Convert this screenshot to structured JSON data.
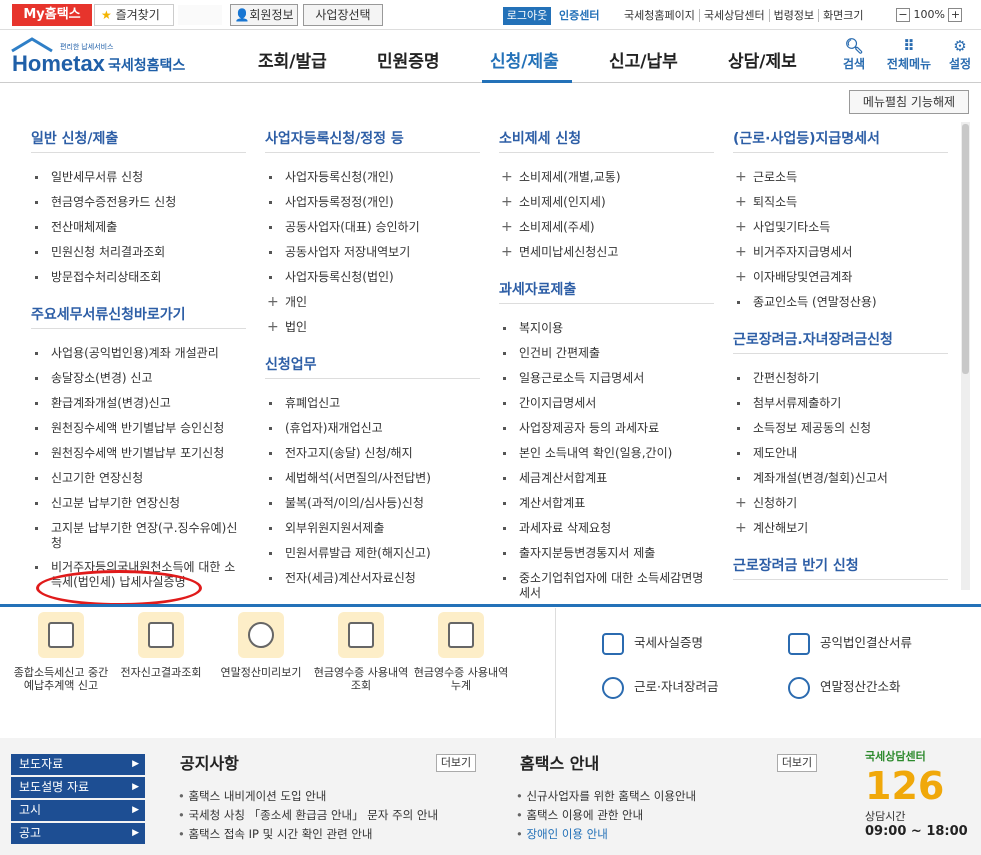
{
  "topbar": {
    "my_hometax": "My홈택스",
    "favorites": "즐겨찾기",
    "member_info": "회원정보",
    "biz_select": "사업장선택",
    "logout": "로그아웃",
    "cert_center": "인증센터",
    "links": [
      "국세청홈페이지",
      "국세상담센터",
      "법령정보",
      "화면크기"
    ],
    "zoom": "100%"
  },
  "logo": {
    "service": "HomeTax",
    "name": "국세청홈택스",
    "tagline": "편리한 납세서비스"
  },
  "gnb": {
    "items": [
      "조회/발급",
      "민원증명",
      "신청/제출",
      "신고/납부",
      "상담/제보"
    ],
    "active": "신청/제출",
    "search": "검색",
    "all_menu": "전체메뉴",
    "settings": "설정"
  },
  "menu": {
    "collapse_label": "메뉴펼침 기능해제",
    "col1": {
      "sec1": "일반 신청/제출",
      "items1": [
        "일반세무서류 신청",
        "현금영수증전용카드 신청",
        "전산매체제출",
        "민원신청 처리결과조회",
        "방문접수처리상태조회"
      ],
      "sec2": "주요세무서류신청바로가기",
      "items2": [
        "사업용(공익법인용)계좌 개설관리",
        "송달장소(변경) 신고",
        "환급계좌개설(변경)신고",
        "원천징수세액 반기별납부 승인신청",
        "원천징수세액 반기별납부 포기신청",
        "신고기한 연장신청",
        "신고분 납부기한 연장신청",
        "고지분 납부기한 연장(구.징수유예)신청",
        "비거주자등의국내원천소득에 대한 소득세(법인세) 납세사실증명"
      ]
    },
    "col2": {
      "sec1": "사업자등록신청/정정 등",
      "items1": [
        "사업자등록신청(개인)",
        "사업자등록정정(개인)",
        "공동사업자(대표) 승인하기",
        "공동사업자 저장내역보기",
        "사업자등록신청(법인)",
        "개인",
        "법인"
      ],
      "sec2": "신청업무",
      "items2": [
        "휴폐업신고",
        "(휴업자)재개업신고",
        "전자고지(송달) 신청/해지",
        "세법해석(서면질의/사전답변)",
        "불복(과적/이의/심사등)신청",
        "외부위원지원서제출",
        "민원서류발급 제한(해지신고)",
        "전자(세금)계산서자료신청"
      ]
    },
    "col3": {
      "sec1": "소비제세 신청",
      "items1": [
        "소비제세(개별,교통)",
        "소비제세(인지세)",
        "소비제세(주세)",
        "면세미납세신청신고"
      ],
      "sec2": "과세자료제출",
      "items2": [
        "복지이용",
        "인건비 간편제출",
        "일용근로소득 지급명세서",
        "간이지급명세서",
        "사업장제공자 등의 과세자료",
        "본인 소득내역 확인(일용,간이)",
        "세금계산서합계표",
        "계산서합계표",
        "과세자료 삭제요청",
        "출자지분등변경통지서 제출",
        "중소기업취업자에 대한 소득세감면명세서"
      ]
    },
    "col4": {
      "sec1": "(근로·사업등)지급명세서",
      "items1": [
        "근로소득",
        "퇴직소득",
        "사업및기타소득",
        "비거주자지급명세서",
        "이자배당및연금계좌",
        "종교인소득 (연말정산용)"
      ],
      "sec2": "근로장려금.자녀장려금신청",
      "items2": [
        "간편신청하기",
        "첨부서류제출하기",
        "소득정보 제공동의 신청",
        "제도안내",
        "계좌개설(변경/철회)신고서",
        "신청하기",
        "계산해보기"
      ],
      "sec3": "근로장려금 반기 신청"
    }
  },
  "shortcuts": [
    "종합소득세신고 중간예납추계액 신고",
    "전자신고결과조회",
    "연말정산미리보기",
    "현금영수증 사용내역조회",
    "현금영수증 사용내역 누계"
  ],
  "right_links": [
    "국세사실증명",
    "공익법인결산서류",
    "근로·자녀장려금",
    "연말정산간소화"
  ],
  "footer": {
    "nav": [
      "보도자료",
      "보도설명 자료",
      "고시",
      "공고"
    ],
    "notice_title": "공지사항",
    "notice_more": "더보기",
    "notices": [
      "홈택스 내비게이션 도입 안내",
      "국세청 사칭 「종소세 환급금 안내」 문자 주의 안내",
      "홈택스 접속 IP 및 시간 확인 관련 안내"
    ],
    "guide_title": "홈택스 안내",
    "guide_more": "더보기",
    "guides": [
      "신규사업자를 위한 홈택스 이용안내",
      "홈택스 이용에 관한 안내",
      "장애인 이용 안내"
    ],
    "center_title": "국세상담센터",
    "center_num": "126",
    "hours_label": "상담시간",
    "hours": "09:00 ~ 18:00"
  }
}
